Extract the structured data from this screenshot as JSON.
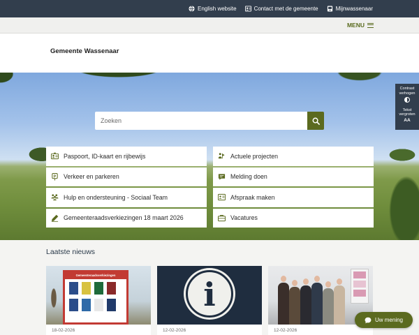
{
  "top_links": [
    {
      "label": "English website",
      "icon": "globe-icon"
    },
    {
      "label": "Contact met de gemeente",
      "icon": "contact-icon"
    },
    {
      "label": "Mijnwassenaar",
      "icon": "account-icon"
    }
  ],
  "menu": {
    "label": "MENU"
  },
  "logo": {
    "text": "Gemeente Wassenaar"
  },
  "search": {
    "placeholder": "Zoeken"
  },
  "quick_links": [
    {
      "label": "Paspoort, ID-kaart en rijbewijs",
      "icon": "id-card-icon"
    },
    {
      "label": "Actuele projecten",
      "icon": "projects-icon"
    },
    {
      "label": "Verkeer en parkeren",
      "icon": "traffic-icon"
    },
    {
      "label": "Melding doen",
      "icon": "report-icon"
    },
    {
      "label": "Hulp en ondersteuning - Sociaal Team",
      "icon": "people-icon"
    },
    {
      "label": "Afspraak maken",
      "icon": "appointment-icon"
    },
    {
      "label": "Gemeenteraadsverkiezingen 18 maart 2026",
      "icon": "pen-icon"
    },
    {
      "label": "Vacatures",
      "icon": "briefcase-icon"
    }
  ],
  "accessibility": {
    "contrast_label": "Contrast verhogen",
    "text_label": "Tekst vergroten",
    "text_symbol": "AA"
  },
  "news": {
    "title": "Laatste nieuws",
    "cards": [
      {
        "date": "18-02-2026",
        "image": "election-board-photo",
        "board_title": "Gemeenteraadsverkiezingen"
      },
      {
        "date": "12-02-2026",
        "image": "info-icon"
      },
      {
        "date": "12-02-2026",
        "image": "group-photo"
      }
    ]
  },
  "feedback": {
    "label": "Uw mening"
  },
  "colors": {
    "topbar": "#323e4d",
    "accent": "#5b6a1f",
    "menu_text": "#5a6b1e"
  }
}
